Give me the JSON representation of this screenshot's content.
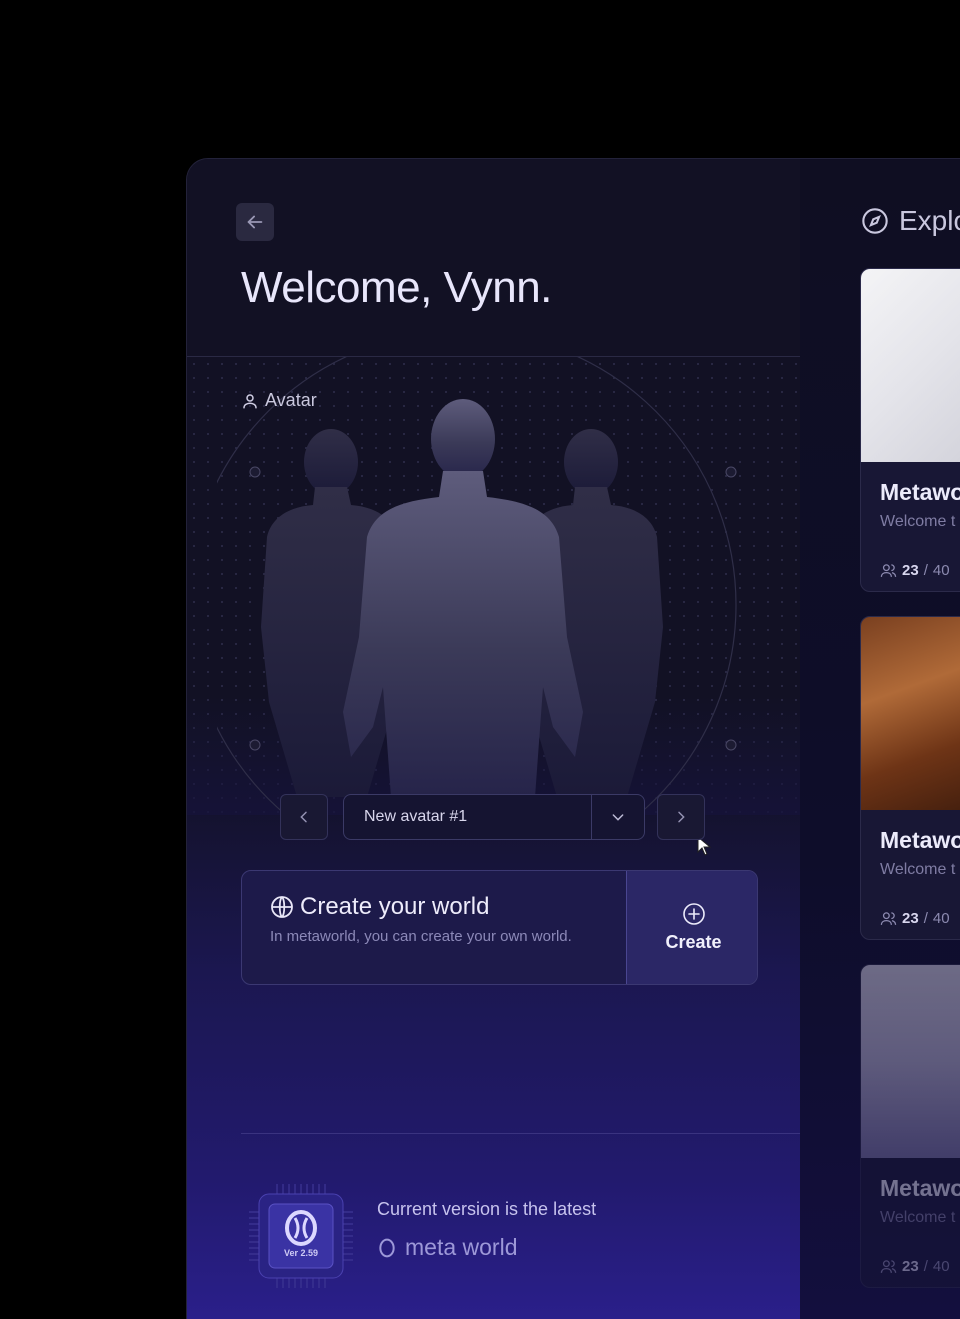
{
  "header": {
    "title": "Welcome, Vynn."
  },
  "avatar": {
    "section_label": "Avatar",
    "selected": "New avatar #1"
  },
  "create_world": {
    "title": "Create your world",
    "description": "In metaworld,  you can create your own world.",
    "button_label": "Create"
  },
  "version": {
    "chip_label": "Ver 2.59",
    "status": "Current version is the latest",
    "brand": "meta world"
  },
  "explore": {
    "title": "Explo",
    "cards": [
      {
        "title": "Metawo",
        "description": "Welcome t",
        "current": "23",
        "max": "40"
      },
      {
        "title": "Metawo",
        "description": "Welcome t",
        "current": "23",
        "max": "40"
      },
      {
        "title": "Metawo",
        "description": "Welcome t",
        "current": "23",
        "max": "40"
      }
    ]
  },
  "colors": {
    "background": "#000000",
    "panel": "#121124",
    "accent": "#2b2766",
    "gradient_end": "#2a1f8a"
  }
}
